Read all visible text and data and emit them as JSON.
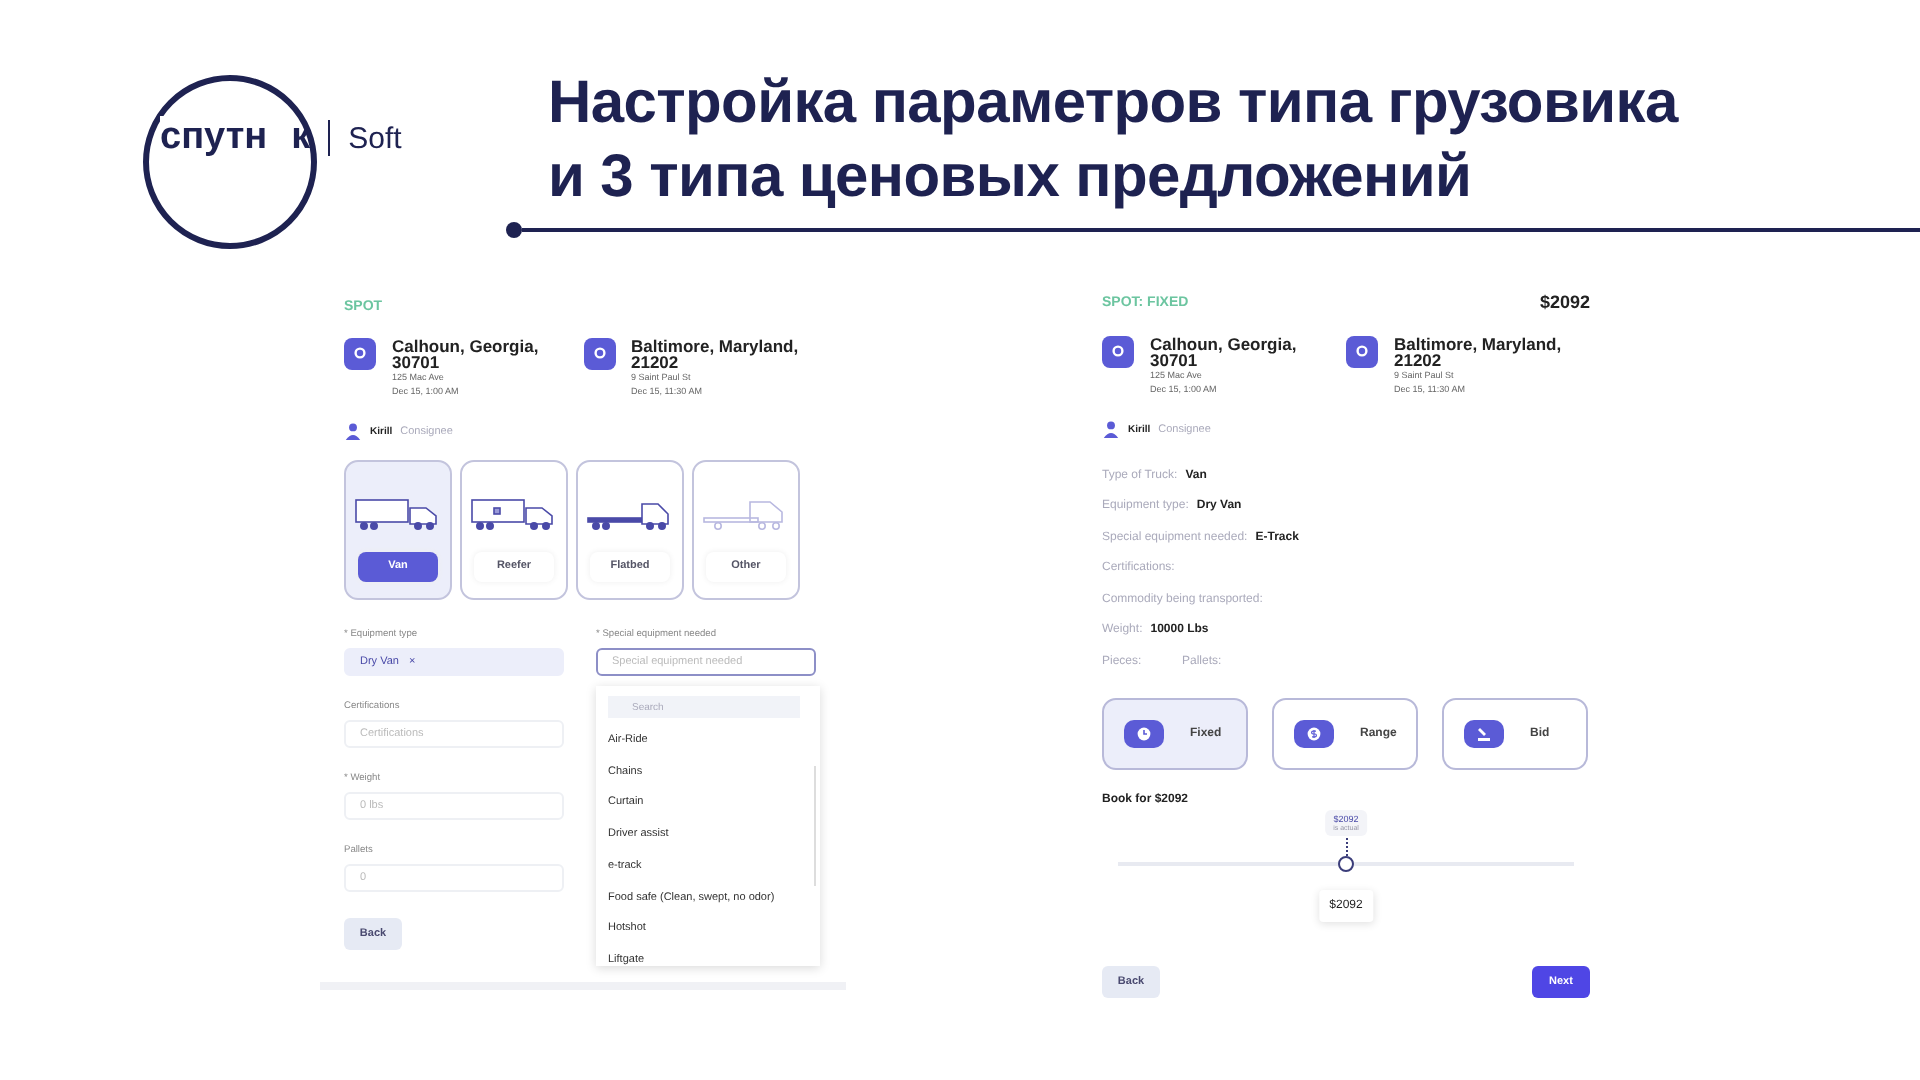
{
  "logo": {
    "text_left": "спутн",
    "text_right": "к",
    "suffix": "Soft"
  },
  "title_lines": [
    "Настройка параметров типа грузовика",
    "и 3 типа ценовых предложений"
  ],
  "left": {
    "label": "SPOT",
    "stops": [
      {
        "city": "Calhoun, Georgia, 30701",
        "address": "125 Mac Ave",
        "time": "Dec 15, 1:00 AM"
      },
      {
        "city": "Baltimore, Maryland, 21202",
        "address": "9 Saint Paul St",
        "time": "Dec 15, 11:30 AM"
      }
    ],
    "contact": {
      "name": "Kirill",
      "role": "Consignee"
    },
    "truck_types": [
      {
        "kind": "van",
        "label": "Van",
        "selected": true
      },
      {
        "kind": "reefer",
        "label": "Reefer",
        "selected": false
      },
      {
        "kind": "flatbed",
        "label": "Flatbed",
        "selected": false
      },
      {
        "kind": "other",
        "label": "Other",
        "selected": false
      }
    ],
    "equipment_type": {
      "label": "* Equipment type",
      "tag": "Dry Van",
      "remove": "×"
    },
    "special_equipment": {
      "label": "* Special equipment needed",
      "placeholder": "Special equipment needed"
    },
    "certifications": {
      "label": "Certifications",
      "placeholder": "Certifications"
    },
    "weight": {
      "label": "* Weight",
      "placeholder": "0 lbs"
    },
    "pallets": {
      "label": "Pallets",
      "placeholder": "0"
    },
    "dropdown": {
      "search_placeholder": "Search",
      "options": [
        "Air-Ride",
        "Chains",
        "Curtain",
        "Driver assist",
        "e-track",
        "Food safe (Clean, swept, no odor)",
        "Hotshot",
        "Liftgate"
      ]
    },
    "back": "Back"
  },
  "right": {
    "label": "SPOT: FIXED",
    "price": "$2092",
    "stops": [
      {
        "city": "Calhoun, Georgia, 30701",
        "address": "125 Mac Ave",
        "time": "Dec 15, 1:00 AM"
      },
      {
        "city": "Baltimore, Maryland, 21202",
        "address": "9 Saint Paul St",
        "time": "Dec 15, 11:30 AM"
      }
    ],
    "contact": {
      "name": "Kirill",
      "role": "Consignee"
    },
    "details": [
      {
        "label": "Type of Truck:",
        "value": "Van"
      },
      {
        "label": "Equipment type:",
        "value": "Dry Van"
      },
      {
        "label": "Special equipment needed:",
        "value": "E-Track"
      },
      {
        "label": "Certifications:"
      },
      {
        "label": "Commodity being transported:"
      },
      {
        "label": "Weight:",
        "value": "10000 Lbs"
      }
    ],
    "pieces_label": "Pieces:",
    "pallets_label": "Pallets:",
    "price_types": [
      {
        "kind": "fixed",
        "label": "Fixed",
        "selected": true
      },
      {
        "kind": "range",
        "label": "Range",
        "selected": false
      },
      {
        "kind": "bid",
        "label": "Bid",
        "selected": false
      }
    ],
    "book_label": "Book for $2092",
    "slider": {
      "level": 0.5,
      "tooltip": "$2092",
      "tooltip_note": "is actual",
      "value": "$2092"
    },
    "back": "Back",
    "next": "Next"
  }
}
